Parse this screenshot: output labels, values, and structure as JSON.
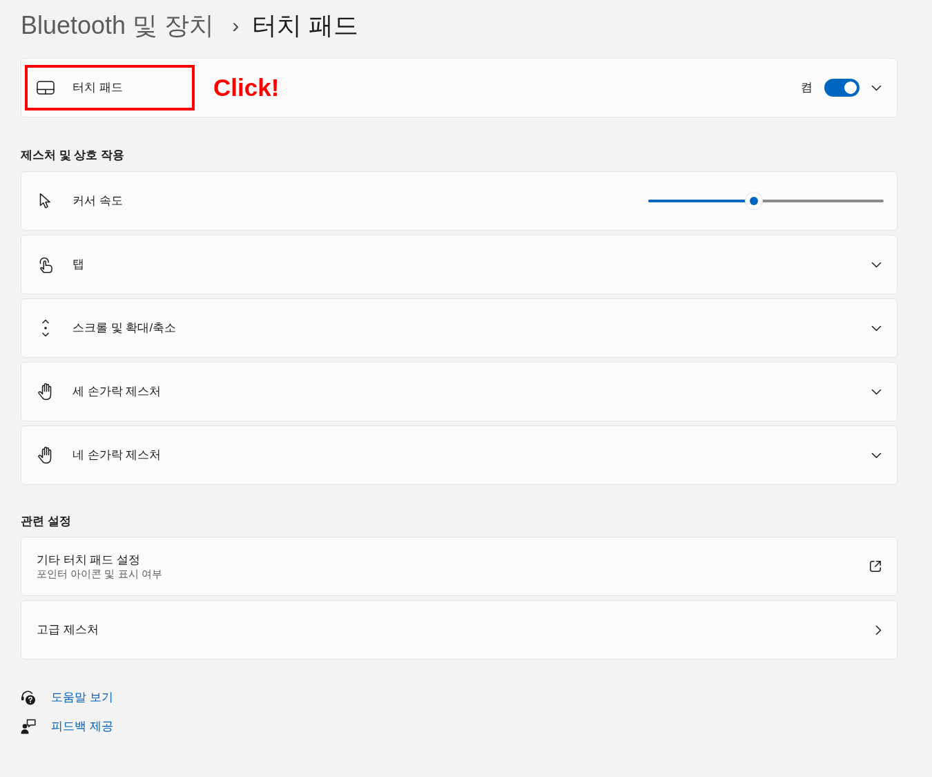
{
  "breadcrumb": {
    "parent": "Bluetooth 및 장치",
    "separator": "›",
    "current": "터치 패드"
  },
  "touchpad": {
    "label": "터치 패드",
    "highlighted": true,
    "annotation": "Click!",
    "state_label": "켬",
    "on": true,
    "expanded": false
  },
  "gestures": {
    "title": "제스처 및 상호 작용",
    "items": [
      {
        "kind": "slider",
        "label": "커서 속도",
        "level": 0.45
      },
      {
        "kind": "expander",
        "label": "탭",
        "expanded": false
      },
      {
        "kind": "expander",
        "label": "스크롤 및 확대/축소",
        "expanded": false
      },
      {
        "kind": "expander",
        "label": "세 손가락 제스처",
        "expanded": false
      },
      {
        "kind": "expander",
        "label": "네 손가락 제스처",
        "expanded": false
      }
    ]
  },
  "related": {
    "title": "관련 설정",
    "items": [
      {
        "kind": "external",
        "label": "기타 터치 패드 설정",
        "description": "포인터 아이콘 및 표시 여부"
      },
      {
        "kind": "navigate",
        "label": "고급 제스처"
      }
    ]
  },
  "links": [
    {
      "label": "도움말 보기"
    },
    {
      "label": "피드백 제공"
    }
  ]
}
